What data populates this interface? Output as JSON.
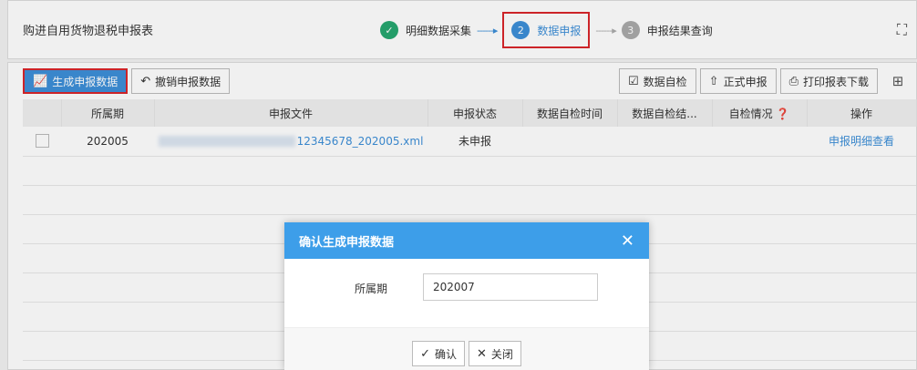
{
  "header": {
    "title": "购进自用货物退税申报表",
    "steps": [
      {
        "num": "✓",
        "label": "明细数据采集"
      },
      {
        "num": "2",
        "label": "数据申报"
      },
      {
        "num": "3",
        "label": "申报结果查询"
      }
    ],
    "arrow": "------▸"
  },
  "toolbar": {
    "generate_label": "生成申报数据",
    "revoke_label": "撤销申报数据",
    "self_check_label": "数据自检",
    "formal_declare_label": "正式申报",
    "print_label": "打印报表下载"
  },
  "table": {
    "columns": [
      "",
      "所属期",
      "申报文件",
      "申报状态",
      "数据自检时间",
      "数据自检结...",
      "自检情况 ❓",
      "操作"
    ],
    "rows": [
      {
        "period": "202005",
        "file": "12345678_202005.xml",
        "status": "未申报",
        "check_time": "",
        "check_result": "",
        "check_status": "",
        "action": "申报明细查看"
      }
    ]
  },
  "modal": {
    "title": "确认生成申报数据",
    "field_label": "所属期",
    "field_value": "202007",
    "confirm_label": "确认",
    "close_label": "关闭"
  },
  "colors": {
    "accent": "#3d8fd8",
    "highlight_border": "#d9262b",
    "done": "#27a770"
  }
}
